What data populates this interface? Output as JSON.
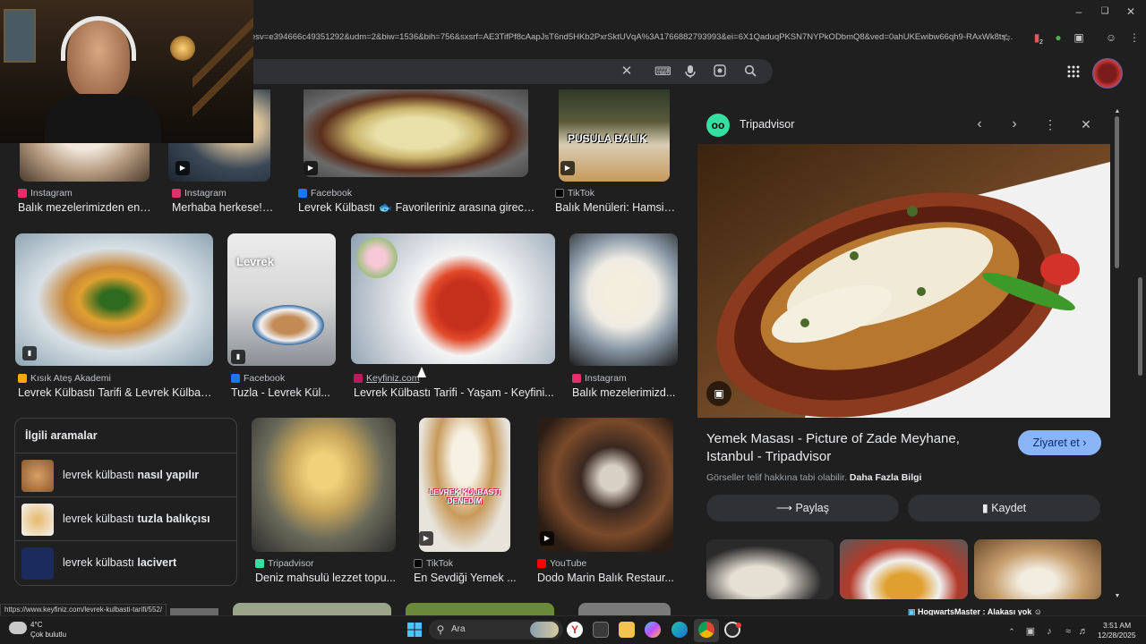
{
  "browser": {
    "url": "esv=e394666c49351292&udm=2&biw=1536&bih=756&sxsrf=AE3TifPf8cAapJsT6nd5HKb2PxrSktUVqA%3A1766882793993&ei=6X1QaduqPKSN7NYPkODbmQ8&ved=0ahUKEwibw66qh9-RAxWk8ts...",
    "extension_badge": "2"
  },
  "grid": {
    "row1": [
      {
        "source": "Instagram",
        "caption": "Balık mezelerimizden en ..."
      },
      {
        "source": "Instagram",
        "caption": "Merhaba herkese!D..."
      },
      {
        "source": "Facebook",
        "caption": "Levrek Külbastı 🐟 Favorileriniz arasına girece..."
      },
      {
        "source": "TikTok",
        "caption": "Balık Menüleri: Hamsi ...",
        "overlay": "PUSULA BALIK"
      }
    ],
    "row2": [
      {
        "source": "Kısık Ateş Akademi",
        "caption": "Levrek Külbastı Tarifi & Levrek Külbas..."
      },
      {
        "source": "Facebook",
        "caption": "Tuzla - Levrek Kül...",
        "overlay": "Levrek"
      },
      {
        "source": "Keyfiniz.com",
        "caption": "Levrek Külbastı Tarifi - Yaşam - Keyfini..."
      },
      {
        "source": "Instagram",
        "caption": "Balık mezelerimizd..."
      }
    ],
    "row3": [
      {
        "source": "Tripadvisor",
        "caption": "Deniz mahsulü lezzet topu..."
      },
      {
        "source": "TikTok",
        "caption": "En Sevdiği Yemek ...",
        "overlay": "LEVREK KÜLBASTI DENEDİM"
      },
      {
        "source": "YouTube",
        "caption": "Dodo Marin Balık Restaur..."
      }
    ]
  },
  "related": {
    "title": "İlgili aramalar",
    "items": [
      {
        "prefix": "levrek külbastı ",
        "bold": "nasıl yapılır"
      },
      {
        "prefix": "levrek külbastı ",
        "bold": "tuzla balıkçısı"
      },
      {
        "prefix": "levrek külbastı ",
        "bold": "lacivert"
      }
    ]
  },
  "panel": {
    "source": "Tripadvisor",
    "title": "Yemek Masası - Picture of Zade Meyhane, Istanbul - Tripadvisor",
    "visit_label": "Ziyaret et",
    "copyright_text": "Görseller telif hakkına tabi olabilir.",
    "copyright_link": "Daha Fazla Bilgi",
    "share_label": "Paylaş",
    "save_label": "Kaydet"
  },
  "status_url": "https://www.keyfiniz.com/levrek-kulbasti-tarifi/552/",
  "stream_ticker": "HogwartsMaster : Alakası yok",
  "taskbar": {
    "weather_temp": "4°C",
    "weather_desc": "Çok bulutlu",
    "search_placeholder": "Ara",
    "time": "3:51 AM",
    "date": "12/28/2025"
  },
  "colors": {
    "accent": "#8ab4f8",
    "background": "#1f1f1f",
    "instagram": "#e1306c",
    "facebook": "#1877f2",
    "tripadvisor": "#34e0a1",
    "youtube": "#ff0000"
  }
}
